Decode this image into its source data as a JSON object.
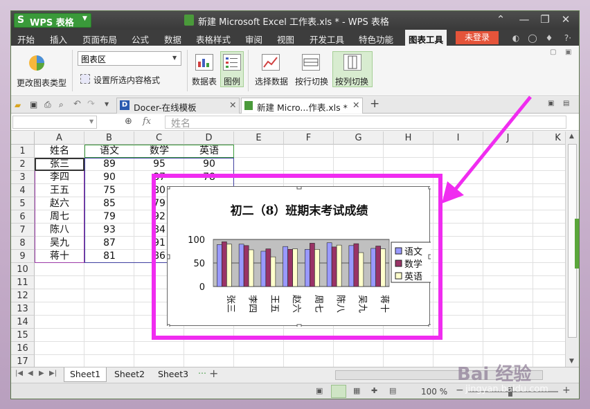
{
  "titlebar": {
    "app_button": "WPS 表格",
    "app_logo": "S",
    "doc_title": "新建 Microsoft Excel 工作表.xls * - WPS 表格"
  },
  "menu": {
    "items": [
      "开始",
      "插入",
      "页面布局",
      "公式",
      "数据",
      "表格样式",
      "审阅",
      "视图",
      "开发工具",
      "特色功能",
      "图表工具"
    ],
    "login": "未登录"
  },
  "ribbon": {
    "change_type": "更改图表类型",
    "chart_area_select": "图表区",
    "format_selection": "设置所选内容格式",
    "data_table": "数据表",
    "legend": "图例",
    "select_data": "选择数据",
    "switch_row": "按行切换",
    "switch_col": "按列切换"
  },
  "tabs": {
    "tab1": "Docer-在线模板",
    "tab2": "新建 Micro...作表.xls *"
  },
  "formula": {
    "fx": "fx",
    "content": "姓名"
  },
  "grid": {
    "columns": [
      "A",
      "B",
      "C",
      "D",
      "E",
      "F",
      "G",
      "H",
      "I",
      "J",
      "K"
    ],
    "rows": [
      "1",
      "2",
      "3",
      "4",
      "5",
      "6",
      "7",
      "8",
      "9",
      "10",
      "11",
      "12",
      "13",
      "14",
      "15",
      "16",
      "17"
    ],
    "headers": [
      "姓名",
      "语文",
      "数学",
      "英语"
    ],
    "names": [
      "张三",
      "李四",
      "王五",
      "赵六",
      "周七",
      "陈八",
      "吴九",
      "蒋十"
    ],
    "chinese": [
      "89",
      "90",
      "75",
      "85",
      "79",
      "93",
      "87",
      "81"
    ],
    "math_visible": [
      "95",
      "87",
      "80",
      "79",
      "92",
      "84",
      "91",
      "86"
    ],
    "english_visible": [
      "90",
      "78"
    ]
  },
  "sheets": [
    "Sheet1",
    "Sheet2",
    "Sheet3"
  ],
  "status": {
    "zoom": "100 %"
  },
  "watermark": {
    "main": "Bai 经验",
    "sub": "jingyan.baidu.com"
  },
  "chart_data": {
    "type": "bar",
    "title": "初二（8）班期末考试成绩",
    "categories": [
      "张三",
      "李四",
      "王五",
      "赵六",
      "周七",
      "陈八",
      "吴九",
      "蒋十"
    ],
    "ylim": [
      0,
      100
    ],
    "yticks": [
      "100",
      "50",
      "0"
    ],
    "legend_position": "right",
    "series": [
      {
        "name": "语文",
        "color": "#9999ff",
        "values": [
          89,
          90,
          75,
          85,
          79,
          93,
          87,
          81
        ]
      },
      {
        "name": "数学",
        "color": "#993366",
        "values": [
          95,
          87,
          80,
          79,
          92,
          84,
          91,
          86
        ]
      },
      {
        "name": "英语",
        "color": "#ffffcc",
        "values": [
          90,
          78,
          63,
          80,
          79,
          88,
          72,
          80
        ]
      }
    ]
  }
}
